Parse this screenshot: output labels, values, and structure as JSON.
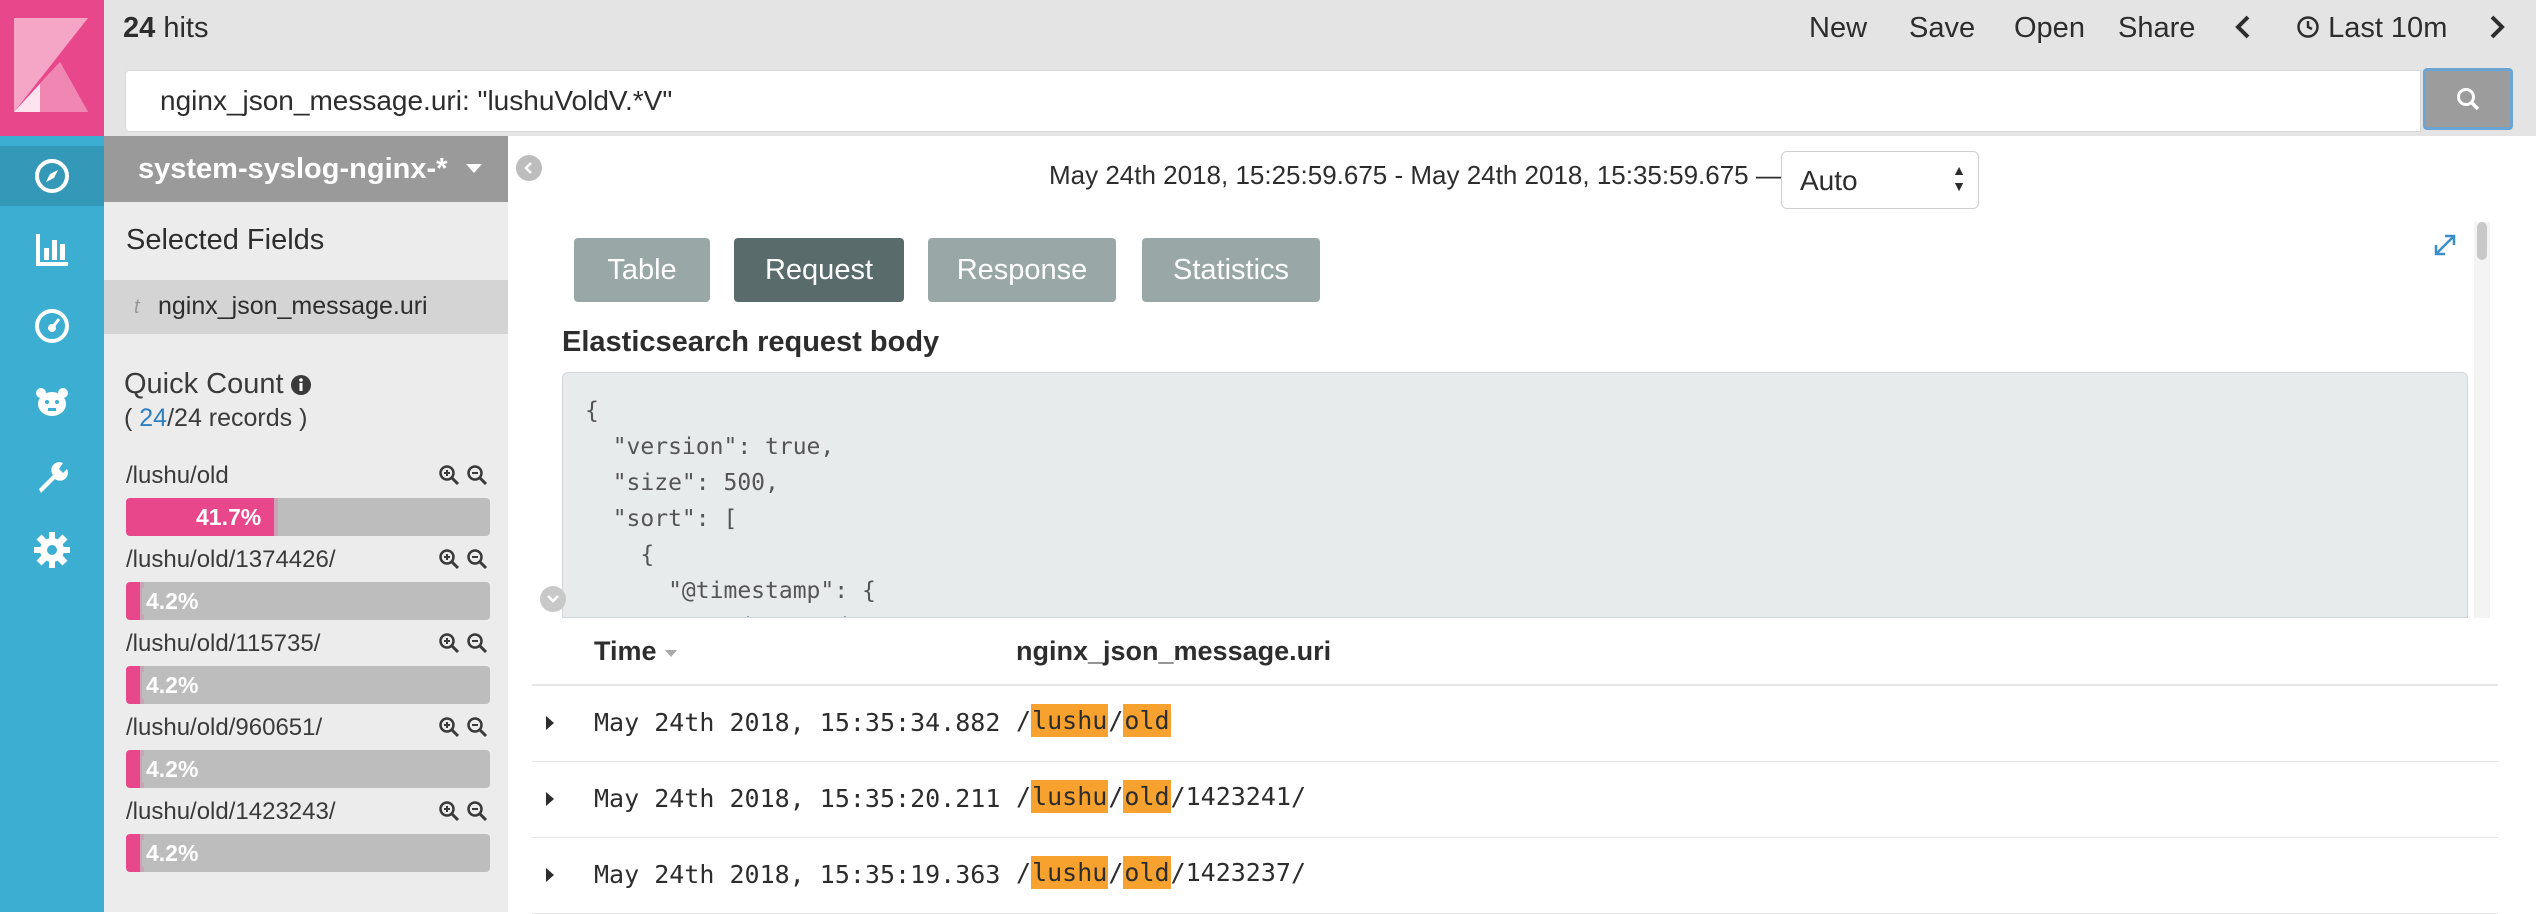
{
  "header": {
    "hits_count": "24",
    "hits_label": "hits",
    "menu": [
      "New",
      "Save",
      "Open",
      "Share"
    ],
    "time_picker_label": "Last 10m",
    "query": "nginx_json_message.uri: \"lushuVoldV.*V\""
  },
  "sidebar": {
    "index_pattern": "system-syslog-nginx-*",
    "selected_fields_title": "Selected Fields",
    "selected_field": "nginx_json_message.uri",
    "selected_field_type": "t",
    "quick_count_title": "Quick Count",
    "quick_count_prefix": "(",
    "quick_count_num": "24",
    "quick_count_suffix": "/24 records )",
    "terms": [
      {
        "label": "/lushu/old",
        "percent_label": "41.7%",
        "fraction": 0.417
      },
      {
        "label": "/lushu/old/1374426/",
        "percent_label": "4.2%",
        "fraction": 0.042
      },
      {
        "label": "/lushu/old/115735/",
        "percent_label": "4.2%",
        "fraction": 0.042
      },
      {
        "label": "/lushu/old/960651/",
        "percent_label": "4.2%",
        "fraction": 0.042
      },
      {
        "label": "/lushu/old/1423243/",
        "percent_label": "4.2%",
        "fraction": 0.042
      }
    ]
  },
  "content": {
    "time_range": "May 24th 2018, 15:25:59.675 - May 24th 2018, 15:35:59.675 —",
    "interval": "Auto",
    "tabs": [
      "Table",
      "Request",
      "Response",
      "Statistics"
    ],
    "active_tab": "Request",
    "request_title": "Elasticsearch request body",
    "request_body": "{\n  \"version\": true,\n  \"size\": 500,\n  \"sort\": [\n    {\n      \"@timestamp\": {\n        \"order\": \"desc\","
  },
  "table": {
    "col_time": "Time",
    "col_uri": "nginx_json_message.uri",
    "rows": [
      {
        "time": "May 24th 2018, 15:35:34.882",
        "uri_parts": [
          "/",
          "lushu",
          "/",
          "old",
          ""
        ]
      },
      {
        "time": "May 24th 2018, 15:35:20.211",
        "uri_parts": [
          "/",
          "lushu",
          "/",
          "old",
          "/1423241/"
        ]
      },
      {
        "time": "May 24th 2018, 15:35:19.363",
        "uri_parts": [
          "/",
          "lushu",
          "/",
          "old",
          "/1423237/"
        ]
      }
    ]
  },
  "colors": {
    "nav": "#3caed2",
    "logo": "#e8488b",
    "highlight": "#f7a22f",
    "bar_fill": "#e8488b",
    "active_tab": "#5a6b6b"
  },
  "icons": [
    "discover-icon",
    "visualize-icon",
    "dashboard-icon",
    "timelion-icon",
    "devtools-icon",
    "management-icon",
    "search-icon",
    "clock-icon",
    "zoom-in-icon",
    "zoom-out-icon",
    "info-icon",
    "expand-icon"
  ]
}
